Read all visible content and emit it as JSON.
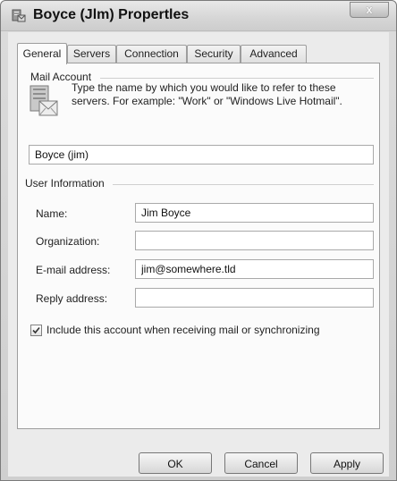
{
  "window": {
    "title": "Boyce (Jlm) Propertles",
    "close_glyph": "x"
  },
  "tabs": [
    {
      "label": "General",
      "active": true
    },
    {
      "label": "Servers",
      "active": false
    },
    {
      "label": "Connection",
      "active": false
    },
    {
      "label": "Security",
      "active": false
    },
    {
      "label": "Advanced",
      "active": false
    }
  ],
  "mail_account": {
    "group_label": "Mail Account",
    "description": "Type the name by which you would like to refer to these servers.  For example: \"Work\" or \"Windows Live Hotmail\".",
    "account_name": "Boyce (jim)"
  },
  "user_information": {
    "group_label": "User Information",
    "fields": [
      {
        "label": "Name:",
        "value": "Jim Boyce"
      },
      {
        "label": "Organization:",
        "value": ""
      },
      {
        "label": "E-mail address:",
        "value": "jim@somewhere.tld"
      },
      {
        "label": "Reply address:",
        "value": ""
      }
    ]
  },
  "include_account": {
    "checked": true,
    "label": "Include this account when receiving mail or synchronizing"
  },
  "buttons": {
    "ok": "OK",
    "cancel": "Cancel",
    "apply": "Apply"
  }
}
